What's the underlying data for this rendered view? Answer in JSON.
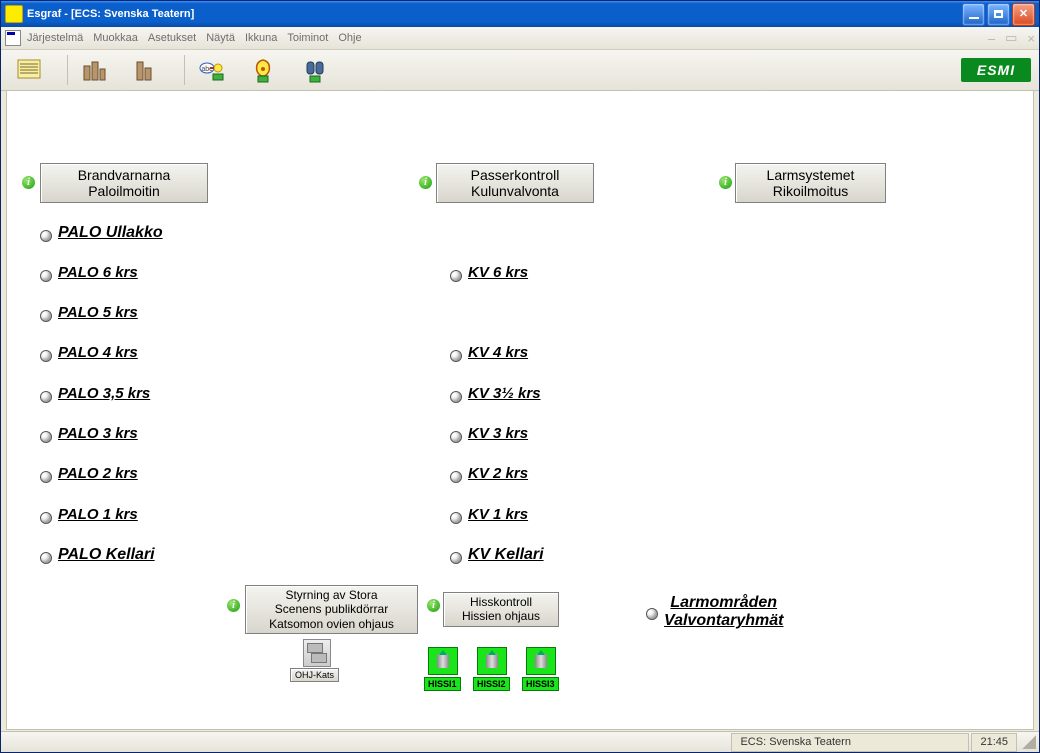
{
  "window": {
    "title": "Esgraf - [ECS: Svenska Teatern]"
  },
  "menu": {
    "items": [
      "Järjestelmä",
      "Muokkaa",
      "Asetukset",
      "Näytä",
      "Ikkuna",
      "Toiminot",
      "Ohje"
    ]
  },
  "toolbar": {
    "logo": "ESMI"
  },
  "headers": {
    "fire": {
      "line1": "Brandvarnarna",
      "line2": "Paloilmoitin"
    },
    "access": {
      "line1": "Passerkontroll",
      "line2": "Kulunvalvonta"
    },
    "alarm": {
      "line1": "Larmsystemet",
      "line2": "Rikoilmoitus"
    }
  },
  "fire_links": [
    "PALO Ullakko",
    "PALO 6 krs",
    "PALO 5 krs",
    "PALO 4 krs",
    "PALO 3,5 krs",
    "PALO 3 krs",
    "PALO 2 krs",
    "PALO 1 krs",
    "PALO Kellari"
  ],
  "kv_links": [
    "KV 6 krs",
    "KV 4 krs",
    "KV 3½ krs",
    "KV 3 krs",
    "KV 2 krs",
    "KV 1 krs",
    "KV Kellari"
  ],
  "sub": {
    "stora": {
      "l1": "Styrning av Stora",
      "l2": "Scenens publikdörrar",
      "l3": "Katsomon ovien ohjaus"
    },
    "hiss": {
      "l1": "Hisskontroll",
      "l2": "Hissien ohjaus"
    },
    "larm": {
      "l1": "Larmområden",
      "l2": "Valvontaryhmät"
    },
    "ohj_label": "OHJ-Kats",
    "hissi_labels": [
      "HISSI1",
      "HISSI2",
      "HISSI3"
    ]
  },
  "status": {
    "center": "ECS: Svenska Teatern",
    "time": "21:45"
  }
}
